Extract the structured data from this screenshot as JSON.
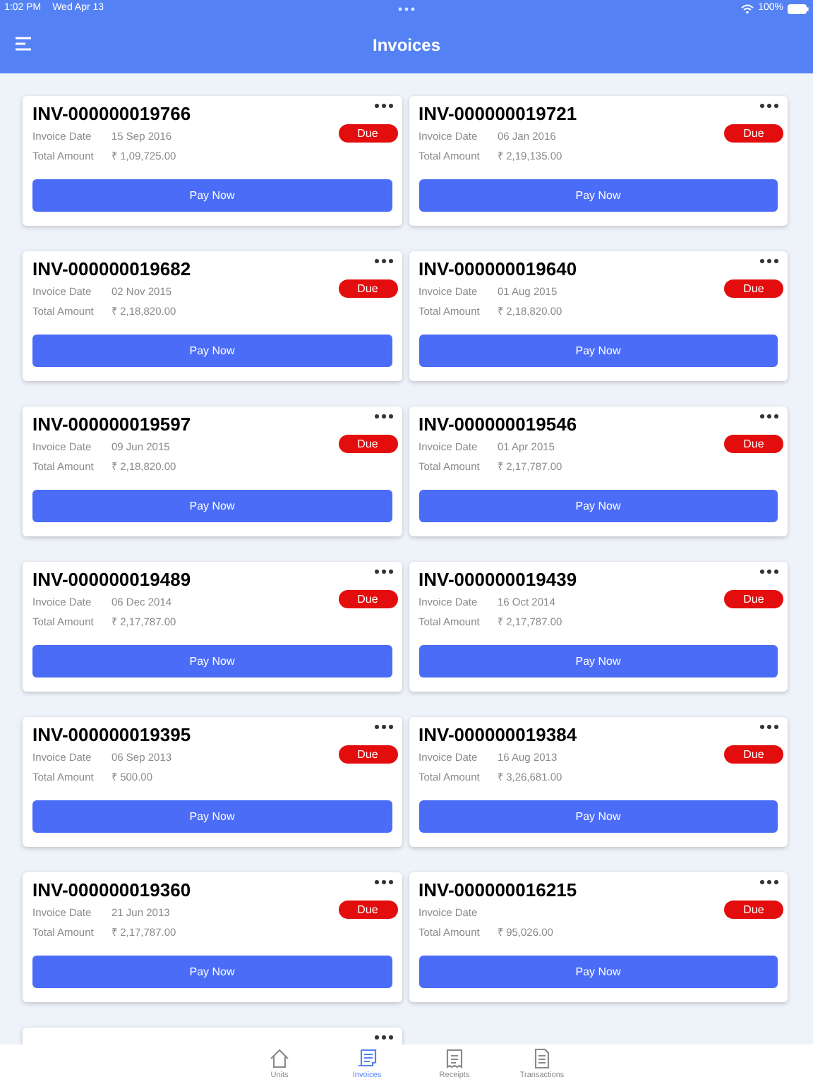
{
  "status_bar": {
    "time": "1:02 PM",
    "date": "Wed Apr 13",
    "battery": "100%"
  },
  "header": {
    "title": "Invoices"
  },
  "invoices": [
    {
      "kind": "full",
      "number": "INV-000000019766",
      "date_label": "Invoice Date",
      "date": "15 Sep 2016",
      "amount_label": "Total Amount",
      "amount": "₹ 1,09,725.00",
      "status": "Due",
      "button": "Pay Now"
    },
    {
      "kind": "full",
      "number": "INV-000000019721",
      "date_label": "Invoice Date",
      "date": "06 Jan 2016",
      "amount_label": "Total Amount",
      "amount": "₹ 2,19,135.00",
      "status": "Due",
      "button": "Pay Now"
    },
    {
      "kind": "full",
      "number": "INV-000000019682",
      "date_label": "Invoice Date",
      "date": "02 Nov 2015",
      "amount_label": "Total Amount",
      "amount": "₹ 2,18,820.00",
      "status": "Due",
      "button": "Pay Now"
    },
    {
      "kind": "full",
      "number": "INV-000000019640",
      "date_label": "Invoice Date",
      "date": "01 Aug 2015",
      "amount_label": "Total Amount",
      "amount": "₹ 2,18,820.00",
      "status": "Due",
      "button": "Pay Now"
    },
    {
      "kind": "full",
      "number": "INV-000000019597",
      "date_label": "Invoice Date",
      "date": "09 Jun 2015",
      "amount_label": "Total Amount",
      "amount": "₹ 2,18,820.00",
      "status": "Due",
      "button": "Pay Now"
    },
    {
      "kind": "full",
      "number": "INV-000000019546",
      "date_label": "Invoice Date",
      "date": "01 Apr 2015",
      "amount_label": "Total Amount",
      "amount": "₹ 2,17,787.00",
      "status": "Due",
      "button": "Pay Now"
    },
    {
      "kind": "full",
      "number": "INV-000000019489",
      "date_label": "Invoice Date",
      "date": "06 Dec 2014",
      "amount_label": "Total Amount",
      "amount": "₹ 2,17,787.00",
      "status": "Due",
      "button": "Pay Now"
    },
    {
      "kind": "full",
      "number": "INV-000000019439",
      "date_label": "Invoice Date",
      "date": "16 Oct 2014",
      "amount_label": "Total Amount",
      "amount": "₹ 2,17,787.00",
      "status": "Due",
      "button": "Pay Now"
    },
    {
      "kind": "full",
      "number": "INV-000000019395",
      "date_label": "Invoice Date",
      "date": "06 Sep 2013",
      "amount_label": "Total Amount",
      "amount": "₹ 500.00",
      "status": "Due",
      "button": "Pay Now"
    },
    {
      "kind": "full",
      "number": "INV-000000019384",
      "date_label": "Invoice Date",
      "date": "16 Aug 2013",
      "amount_label": "Total Amount",
      "amount": "₹ 3,26,681.00",
      "status": "Due",
      "button": "Pay Now"
    },
    {
      "kind": "full",
      "number": "INV-000000019360",
      "date_label": "Invoice Date",
      "date": "21 Jun 2013",
      "amount_label": "Total Amount",
      "amount": "₹ 2,17,787.00",
      "status": "Due",
      "button": "Pay Now"
    },
    {
      "kind": "full",
      "number": "INV-000000016215",
      "date_label": "Invoice Date",
      "amount_label": "Total Amount",
      "amount": "₹ 95,026.00",
      "status": "Due",
      "button": "Pay Now"
    },
    {
      "kind": "partial"
    }
  ],
  "tab_bar": [
    {
      "label": "Units",
      "kind": "home",
      "selected": false
    },
    {
      "label": "Invoices",
      "kind": "invoice",
      "selected": true
    },
    {
      "label": "Receipts",
      "kind": "receipt",
      "selected": false
    },
    {
      "label": "Transactions",
      "kind": "document",
      "selected": false
    }
  ]
}
